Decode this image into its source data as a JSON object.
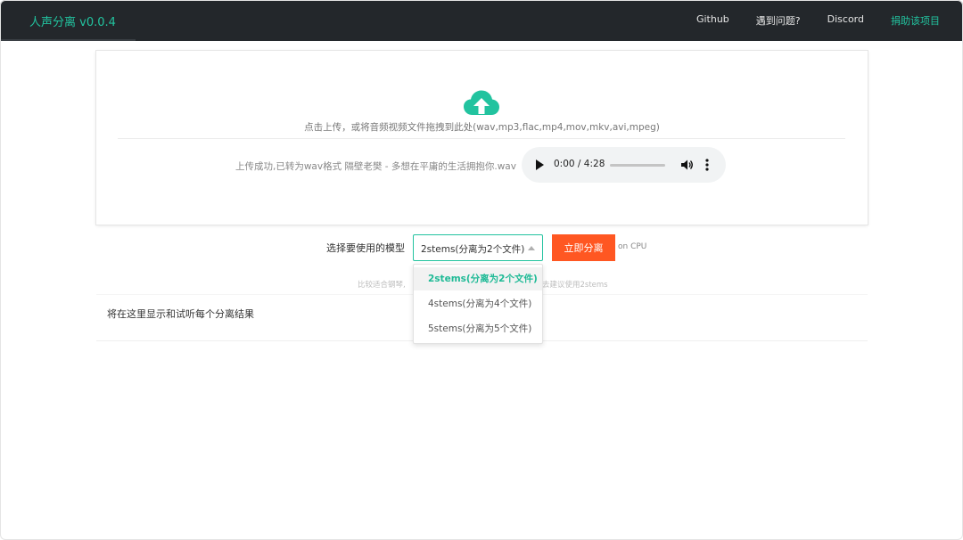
{
  "navbar": {
    "brand": "人声分离 v0.0.4",
    "links": [
      {
        "label": "Github"
      },
      {
        "label": "遇到问题?"
      },
      {
        "label": "Discord"
      },
      {
        "label": "捐助该项目"
      }
    ]
  },
  "upload": {
    "icon": "cloud-upload-icon",
    "hint": "点击上传，或将音频视频文件拖拽到此处(wav,mp3,flac,mp4,mov,mkv,avi,mpeg)",
    "status": "上传成功,已转为wav格式 隔壁老樊 - 多想在平庸的生活拥抱你.wav",
    "player": {
      "time": "0:00 / 4:28",
      "progress": 0
    }
  },
  "model": {
    "label": "选择要使用的模型",
    "selected": "2stems(分离为2个文件)",
    "options": [
      "2stems(分离为2个文件)",
      "4stems(分离为4个文件)",
      "5stems(分离为5个文件)"
    ],
    "help_left": "比较适合钢琴,",
    "help_right": "去建议使用2stems"
  },
  "actions": {
    "separate": "立即分离",
    "device": "on CPU"
  },
  "results": {
    "placeholder": "将在这里显示和试听每个分离结果"
  },
  "colors": {
    "accent": "#22c39f",
    "button": "#ff5722",
    "navbar": "#23272b"
  }
}
